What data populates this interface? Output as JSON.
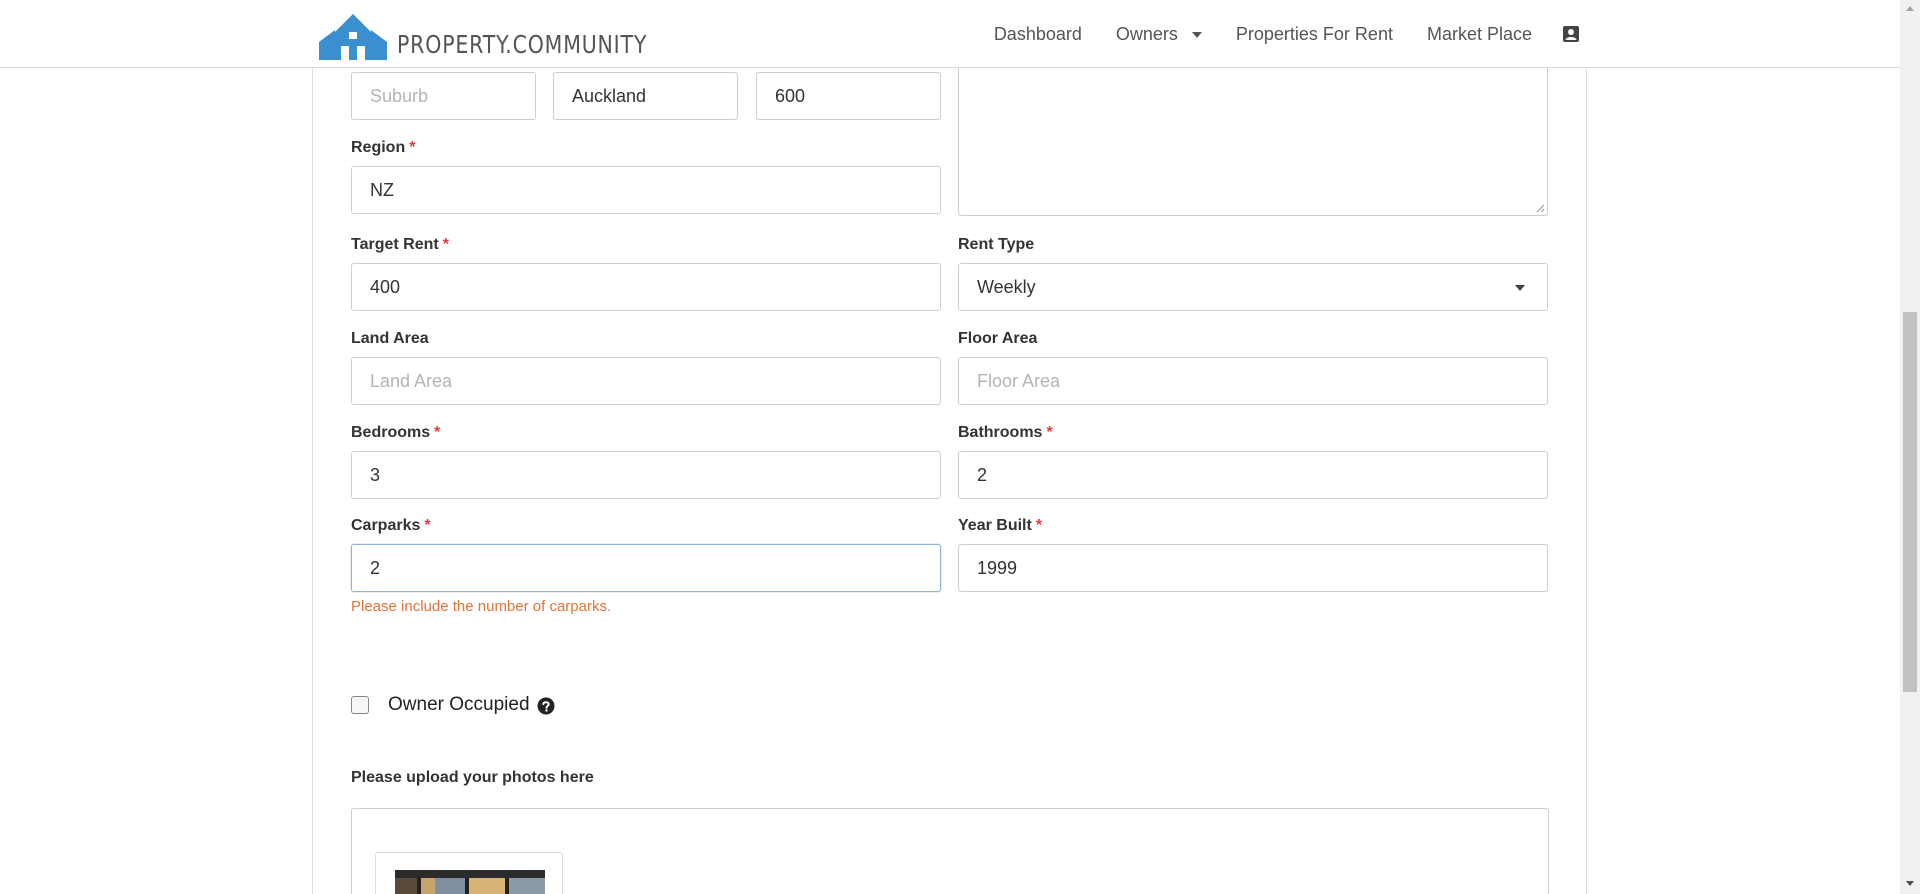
{
  "header": {
    "logo_text": "PROPERTY.COMMUNITY",
    "nav": {
      "dashboard": "Dashboard",
      "owners": "Owners",
      "properties_for_rent": "Properties For Rent",
      "market_place": "Market Place"
    }
  },
  "form": {
    "suburb": {
      "value": "",
      "placeholder": "Suburb"
    },
    "city": {
      "value": "Auckland"
    },
    "postcode": {
      "value": "600"
    },
    "region": {
      "label": "Region",
      "required": "*",
      "value": "NZ"
    },
    "target_rent": {
      "label": "Target Rent",
      "required": "*",
      "value": "400"
    },
    "rent_type": {
      "label": "Rent Type",
      "value": "Weekly"
    },
    "land_area": {
      "label": "Land Area",
      "placeholder": "Land Area"
    },
    "floor_area": {
      "label": "Floor Area",
      "placeholder": "Floor Area"
    },
    "bedrooms": {
      "label": "Bedrooms",
      "required": "*",
      "value": "3"
    },
    "bathrooms": {
      "label": "Bathrooms",
      "required": "*",
      "value": "2"
    },
    "carparks": {
      "label": "Carparks",
      "required": "*",
      "value": "2",
      "error": "Please include the number of carparks."
    },
    "year_built": {
      "label": "Year Built",
      "required": "*",
      "value": "1999"
    },
    "owner_occupied": {
      "label": "Owner Occupied",
      "checked": false
    },
    "photos": {
      "label": "Please upload your photos here"
    }
  },
  "colors": {
    "brand": "#3a8fd0",
    "required": "#e0393e",
    "error": "#e0743a"
  },
  "icons": {
    "logo": "house-logo-icon",
    "user": "user-card-icon",
    "help": "question-circle-icon",
    "dropdown": "caret-down-icon"
  }
}
